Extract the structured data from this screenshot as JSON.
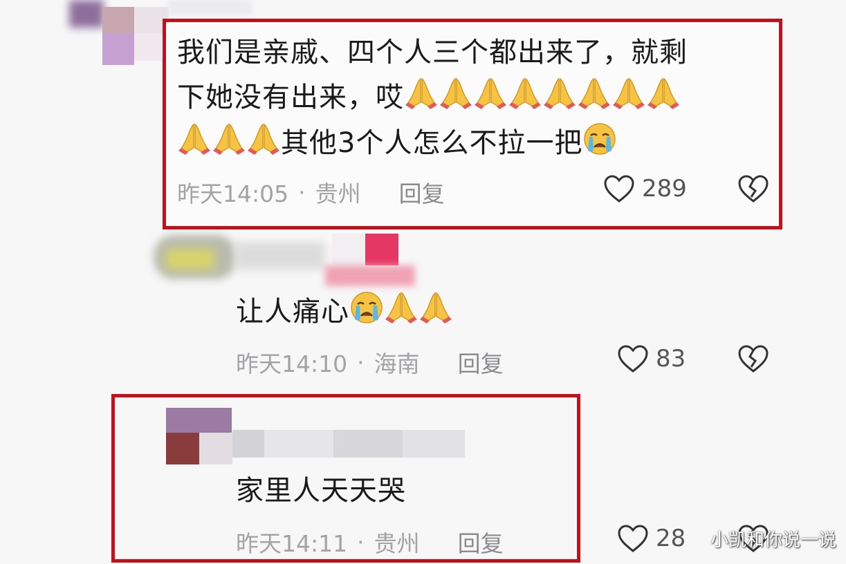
{
  "comments": [
    {
      "text_line1": "我们是亲戚、四个人三个都出来了，就剩",
      "text_line2": "下她没有出来，哎",
      "text_line3": "其他3个人怎么不拉一把",
      "time": "昨天14:05",
      "sep": "·",
      "location": "贵州",
      "reply": "回复",
      "likes": "289"
    },
    {
      "text": "让人痛心",
      "time": "昨天14:10",
      "sep": "·",
      "location": "海南",
      "reply": "回复",
      "likes": "83"
    },
    {
      "text": "家里人天天哭",
      "time": "昨天14:11",
      "sep": "·",
      "location": "贵州",
      "reply": "回复",
      "likes": "28"
    }
  ],
  "icons": {
    "pray": "folded-hands-emoji",
    "cry": "crying-face-emoji",
    "like": "heart-icon",
    "dislike": "broken-heart-icon"
  },
  "colors": {
    "highlight_frame": "#c4101b",
    "meta_text": "#a3a3a6"
  },
  "watermark": "小凯和你说一说"
}
